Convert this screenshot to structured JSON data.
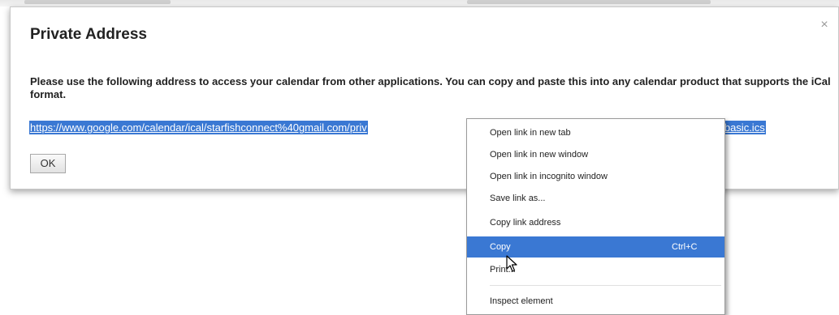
{
  "dialog": {
    "title": "Private Address",
    "close_glyph": "×",
    "message": "Please use the following address to access your calendar from other applications. You can copy and paste this into any calendar product that supports the iCal format.",
    "link_start": "https://www.google.com/calendar/ical/starfishconnect%40gmail.com/priv",
    "link_end": "7/basic.ics",
    "ok_label": "OK"
  },
  "context_menu": {
    "items": [
      {
        "label": "Open link in new tab",
        "shortcut": ""
      },
      {
        "label": "Open link in new window",
        "shortcut": ""
      },
      {
        "label": "Open link in incognito window",
        "shortcut": ""
      },
      {
        "label": "Save link as...",
        "shortcut": ""
      },
      {
        "label": "Copy link address",
        "shortcut": ""
      },
      {
        "label": "Copy",
        "shortcut": "Ctrl+C"
      },
      {
        "label": "Print...",
        "shortcut": ""
      },
      {
        "label": "Inspect element",
        "shortcut": ""
      }
    ],
    "highlighted_item": "Copy"
  },
  "colors": {
    "selection": "#3a78d3",
    "menu_highlight": "#3a78d3"
  },
  "icons": {
    "close": "close-icon",
    "cursor": "mouse-pointer-icon"
  }
}
